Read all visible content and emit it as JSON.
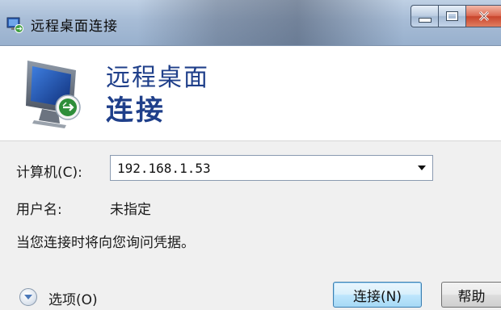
{
  "window": {
    "title": "远程桌面连接",
    "icon": "remote-desktop-icon"
  },
  "banner": {
    "line1": "远程桌面",
    "line2": "连接",
    "icon": "remote-desktop-monitor-icon",
    "title_color": "#1f3f8a"
  },
  "form": {
    "computer_label": "计算机(C):",
    "computer_value": "192.168.1.53",
    "username_label": "用户名:",
    "username_value": "未指定",
    "credentials_note": "当您连接时将向您询问凭据。"
  },
  "footer": {
    "options_label": "选项(O)",
    "connect_label": "连接(N)",
    "help_label": "帮助"
  },
  "colors": {
    "close_button": "#c8442c",
    "default_button_border": "#3c7fb1"
  }
}
